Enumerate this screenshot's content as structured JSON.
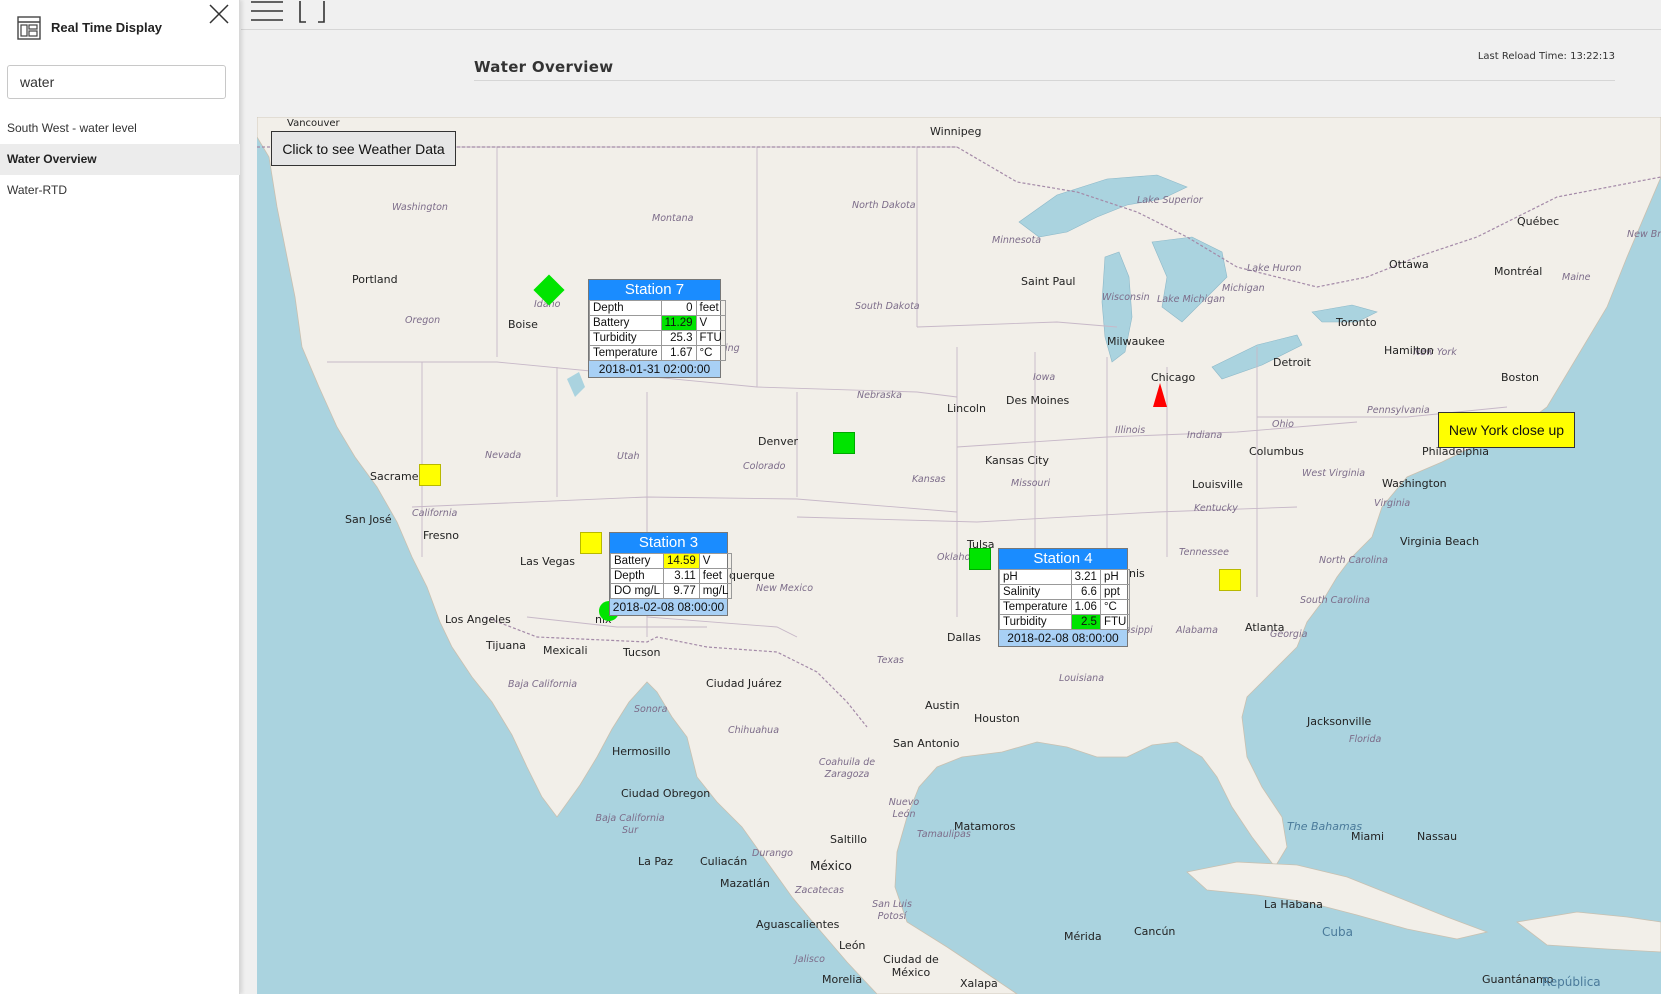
{
  "app": {
    "title": "Real Time Display"
  },
  "search": {
    "value": "water"
  },
  "nav": {
    "items": [
      {
        "label": "South West - water level"
      },
      {
        "label": "Water Overview"
      },
      {
        "label": "Water-RTD"
      }
    ]
  },
  "header": {
    "title": "Water Overview",
    "reload": "Last Reload Time: 13:22:13"
  },
  "map": {
    "weather_button": "Click to see Weather Data",
    "ny_button": "New York close up",
    "cities": [
      "Vancouver",
      "Winnipeg",
      "Portland",
      "Boise",
      "Saint Paul",
      "Ottawa",
      "Montréal",
      "Québec",
      "Toronto",
      "Hamilton",
      "Milwaukee",
      "Detroit",
      "Chicago",
      "Boston",
      "Des Moines",
      "Lincoln",
      "Denver",
      "Kansas City",
      "Columbus",
      "Philadelphia",
      "Washington",
      "Louisville",
      "Sacramer",
      "San José",
      "Fresno",
      "Las Vegas",
      "Los Angeles",
      "Tijuana",
      "Mexicali",
      "Tucson",
      "querque",
      "nix",
      "Tulsa",
      "nis",
      "Virginia Beach",
      "Atlanta",
      "Dallas",
      "Ciudad Juárez",
      "Austin",
      "Houston",
      "San Antonio",
      "Jacksonville",
      "Hermosillo",
      "Ciudad Obregon",
      "Saltillo",
      "Matamoros",
      "La Paz",
      "Culiacán",
      "Mazatlán",
      "México",
      "Miami",
      "Nassau",
      "The Bahamas",
      "La Habana",
      "Cuba",
      "Mérida",
      "Cancún",
      "Aguascalientes",
      "León",
      "Ciudad de México",
      "Morelia",
      "Xalapa",
      "Guantánamo",
      "República"
    ],
    "regions": [
      "Washington",
      "Montana",
      "North Dakota",
      "Minnesota",
      "Lake Superior",
      "Oregon",
      "Idaho",
      "South Dakota",
      "Wisconsin",
      "Michigan",
      "Lake Huron",
      "Lake Michigan",
      "New York",
      "Maine",
      "New Bru",
      "Iowa",
      "Nebraska",
      "Pennsylvania",
      "Ohio",
      "Illinois",
      "Indiana",
      "Nevada",
      "Utah",
      "Colorado",
      "Kansas",
      "Missouri",
      "West Virginia",
      "Virginia",
      "Kentucky",
      "California",
      "Tennessee",
      "North Carolina",
      "Oklahoma",
      "New Mexico",
      "South Carolina",
      "Mississippi",
      "Alabama",
      "Georgia",
      "Texas",
      "Louisiana",
      "Baja California",
      "Sonora",
      "Chihuahua",
      "Coahuila de Zaragoza",
      "Nuevo León",
      "Tamaulipas",
      "Florida",
      "Baja California Sur",
      "Durango",
      "Zacatecas",
      "San Luis Potosí",
      "Jalisco",
      "ing"
    ],
    "colors": {
      "land": "#f2efe9",
      "water": "#aad3df",
      "accent": "#1a8cff",
      "alert_green": "#00e400",
      "alert_yellow": "#ffff00",
      "alert_red": "#ff0000"
    }
  },
  "stations": {
    "s7": {
      "title": "Station 7",
      "rows": [
        {
          "label": "Depth",
          "value": "0",
          "unit": "feet"
        },
        {
          "label": "Battery",
          "value": "11.29",
          "unit": "V"
        },
        {
          "label": "Turbidity",
          "value": "25.3",
          "unit": "FTU"
        },
        {
          "label": "Temperature",
          "value": "1.67",
          "unit": "°C"
        }
      ],
      "timestamp": "2018-01-31 02:00:00"
    },
    "s3": {
      "title": "Station 3",
      "rows": [
        {
          "label": "Battery",
          "value": "14.59",
          "unit": "V"
        },
        {
          "label": "Depth",
          "value": "3.11",
          "unit": "feet"
        },
        {
          "label": "DO mg/L",
          "value": "9.77",
          "unit": "mg/L"
        }
      ],
      "timestamp": "2018-02-08 08:00:00"
    },
    "s4": {
      "title": "Station 4",
      "rows": [
        {
          "label": "pH",
          "value": "3.21",
          "unit": "pH"
        },
        {
          "label": "Salinity",
          "value": "6.6",
          "unit": "ppt"
        },
        {
          "label": "Temperature",
          "value": "1.06",
          "unit": "°C"
        },
        {
          "label": "Turbidity",
          "value": "2.5",
          "unit": "FTU"
        }
      ],
      "timestamp": "2018-02-08 08:00:00"
    }
  }
}
